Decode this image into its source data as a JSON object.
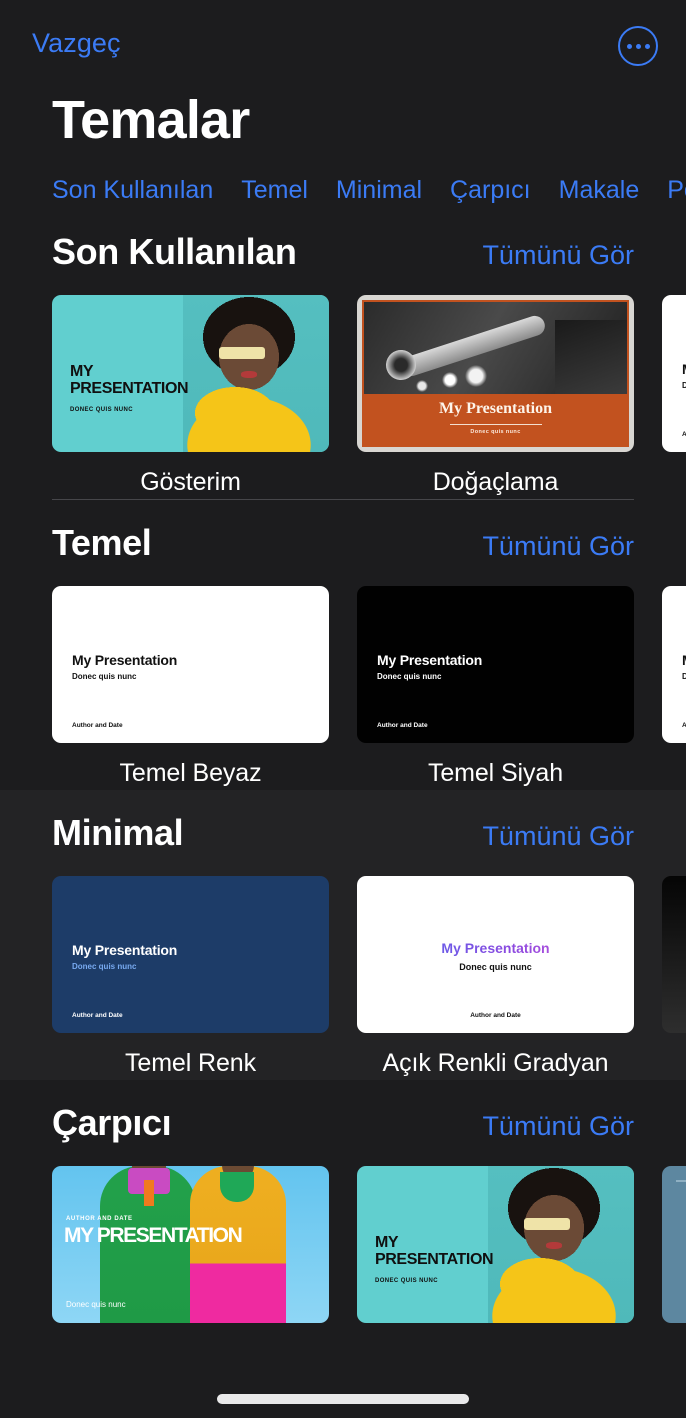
{
  "navbar": {
    "cancel_label": "Vazgeç",
    "more_icon": "ellipsis-circle-icon"
  },
  "page_title": "Temalar",
  "accent_color": "#3b7bf5",
  "tabs": [
    {
      "label": "Son Kullanılan"
    },
    {
      "label": "Temel"
    },
    {
      "label": "Minimal"
    },
    {
      "label": "Çarpıcı"
    },
    {
      "label": "Makale"
    },
    {
      "label": "Po"
    }
  ],
  "see_all_label": "Tümünü Gör",
  "slide_text": {
    "title_caps": "MY PRESENTATION",
    "title_caps_line1": "MY",
    "title_caps_line2": "PRESENTATION",
    "subtitle_caps": "DONEC QUIS NUNC",
    "title_mixed": "My Presentation",
    "subtitle_mixed": "Donec quis nunc",
    "author": "Author and Date",
    "author_caps": "AUTHOR AND DATE",
    "subtitle_tiny": "Donec quis nunc"
  },
  "sections": [
    {
      "id": "son-kullanilan",
      "title": "Son Kullanılan",
      "see_all": "Tümünü Gör",
      "cards": [
        {
          "label": "Gösterim",
          "style": "gosterim"
        },
        {
          "label": "Doğaçlama",
          "style": "dogaclama"
        },
        {
          "label": "",
          "style": "white-partial"
        }
      ]
    },
    {
      "id": "temel",
      "title": "Temel",
      "see_all": "Tümünü Gör",
      "cards": [
        {
          "label": "Temel Beyaz",
          "style": "white"
        },
        {
          "label": "Temel Siyah",
          "style": "black"
        },
        {
          "label": "",
          "style": "white-partial"
        }
      ]
    },
    {
      "id": "minimal",
      "title": "Minimal",
      "see_all": "Tümünü Gör",
      "cards": [
        {
          "label": "Temel Renk",
          "style": "navy"
        },
        {
          "label": "Açık Renkli Gradyan",
          "style": "gradient"
        },
        {
          "label": "",
          "style": "dark-gradient-partial"
        }
      ]
    },
    {
      "id": "carpici",
      "title": "Çarpıcı",
      "see_all": "Tümünü Gör",
      "cards": [
        {
          "label": "",
          "style": "bold-people"
        },
        {
          "label": "",
          "style": "bold-teal"
        },
        {
          "label": "",
          "style": "steel-partial"
        }
      ]
    }
  ]
}
